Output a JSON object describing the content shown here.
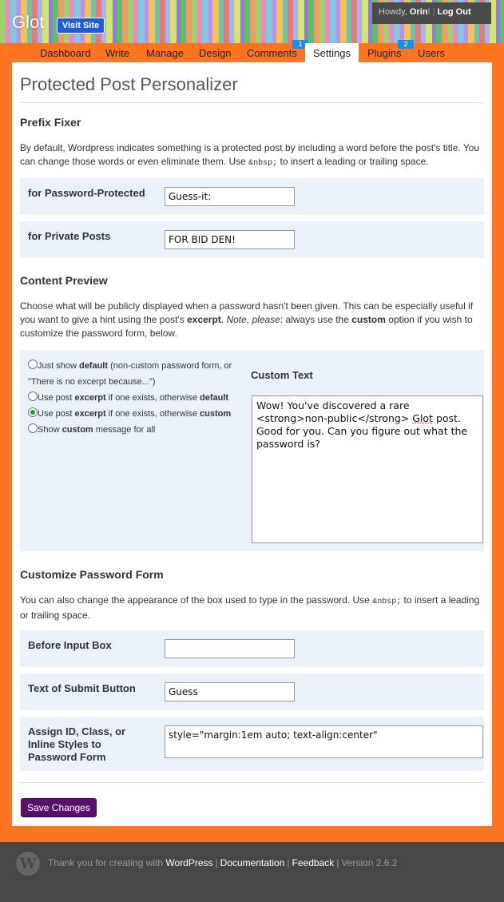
{
  "header": {
    "site_title": "Glot",
    "visit_site": "Visit Site",
    "howdy_prefix": "Howdy, ",
    "user_name": "Orin",
    "howdy_suffix": "!",
    "separator": "|",
    "logout": "Log Out"
  },
  "nav": {
    "items": [
      {
        "label": "Dashboard"
      },
      {
        "label": "Write"
      },
      {
        "label": "Manage"
      },
      {
        "label": "Design"
      },
      {
        "label": "Comments",
        "badge": "1"
      },
      {
        "label": "Settings",
        "active": true
      },
      {
        "label": "Plugins",
        "badge": "2"
      },
      {
        "label": "Users"
      }
    ]
  },
  "page": {
    "title": "Protected Post Personalizer"
  },
  "prefix_fixer": {
    "heading": "Prefix Fixer",
    "desc_1": "By default, Wordpress indicates something is a protected post by including a word before the post's title. You can change those words or even eliminate them. Use ",
    "desc_code": "&nbsp;",
    "desc_2": " to insert a leading or trailing space.",
    "password_label": "for Password-Protected",
    "password_value": "Guess-it:",
    "private_label": "for Private Posts",
    "private_value": "FOR BID DEN!"
  },
  "content_preview": {
    "heading": "Content Preview",
    "desc_1": "Choose what will be publicly displayed when a password hasn't been given. This can be especially useful if you want to give a hint using the post's ",
    "desc_excerpt": "excerpt",
    "desc_2": ". ",
    "desc_note": "Note, please",
    "desc_3": ": always use the ",
    "desc_custom": "custom",
    "desc_4": " option if you wish to customize the password form, below.",
    "options": [
      {
        "pre": "Just show ",
        "bold": "default",
        "post": " (non-custom password form, or \"There is no excerpt because...\")",
        "checked": false
      },
      {
        "pre": "Use post ",
        "bold": "excerpt",
        "post": " if one exists, otherwise ",
        "bold2": "default",
        "checked": false
      },
      {
        "pre": "Use post ",
        "bold": "excerpt",
        "post": " if one exists, otherwise ",
        "bold2": "custom",
        "checked": true
      },
      {
        "pre": "Show ",
        "bold": "custom",
        "post": " message for all",
        "checked": false
      }
    ],
    "custom_text_label": "Custom Text",
    "custom_text_1": "Wow! You've discovered a rare <strong>non-public</strong> ",
    "custom_text_glot": "Glot",
    "custom_text_2": " post. Good for you. Can you figure out what the password is?"
  },
  "password_form": {
    "heading": "Customize Password Form",
    "desc_1": "You can also change the appearance of the box used to type in the password. Use ",
    "desc_code": "&nbsp;",
    "desc_2": " to insert a leading or trailing space.",
    "before_label": "Before Input Box",
    "before_value": "",
    "submit_label": "Text of Submit Button",
    "submit_value": "Guess",
    "assign_label_1": "Assign ID, Class, or",
    "assign_label_2": "Inline Styles to",
    "assign_label_3": "Password Form",
    "assign_value": "style=\"margin:1em auto; text-align:center\""
  },
  "save_button": "Save Changes",
  "footer": {
    "thanks": "Thank you for creating with ",
    "wordpress": "WordPress",
    "sep": "|",
    "documentation": "Documentation",
    "feedback": "Feedback",
    "version": "Version 2.6.2",
    "logo_letter": "W"
  }
}
